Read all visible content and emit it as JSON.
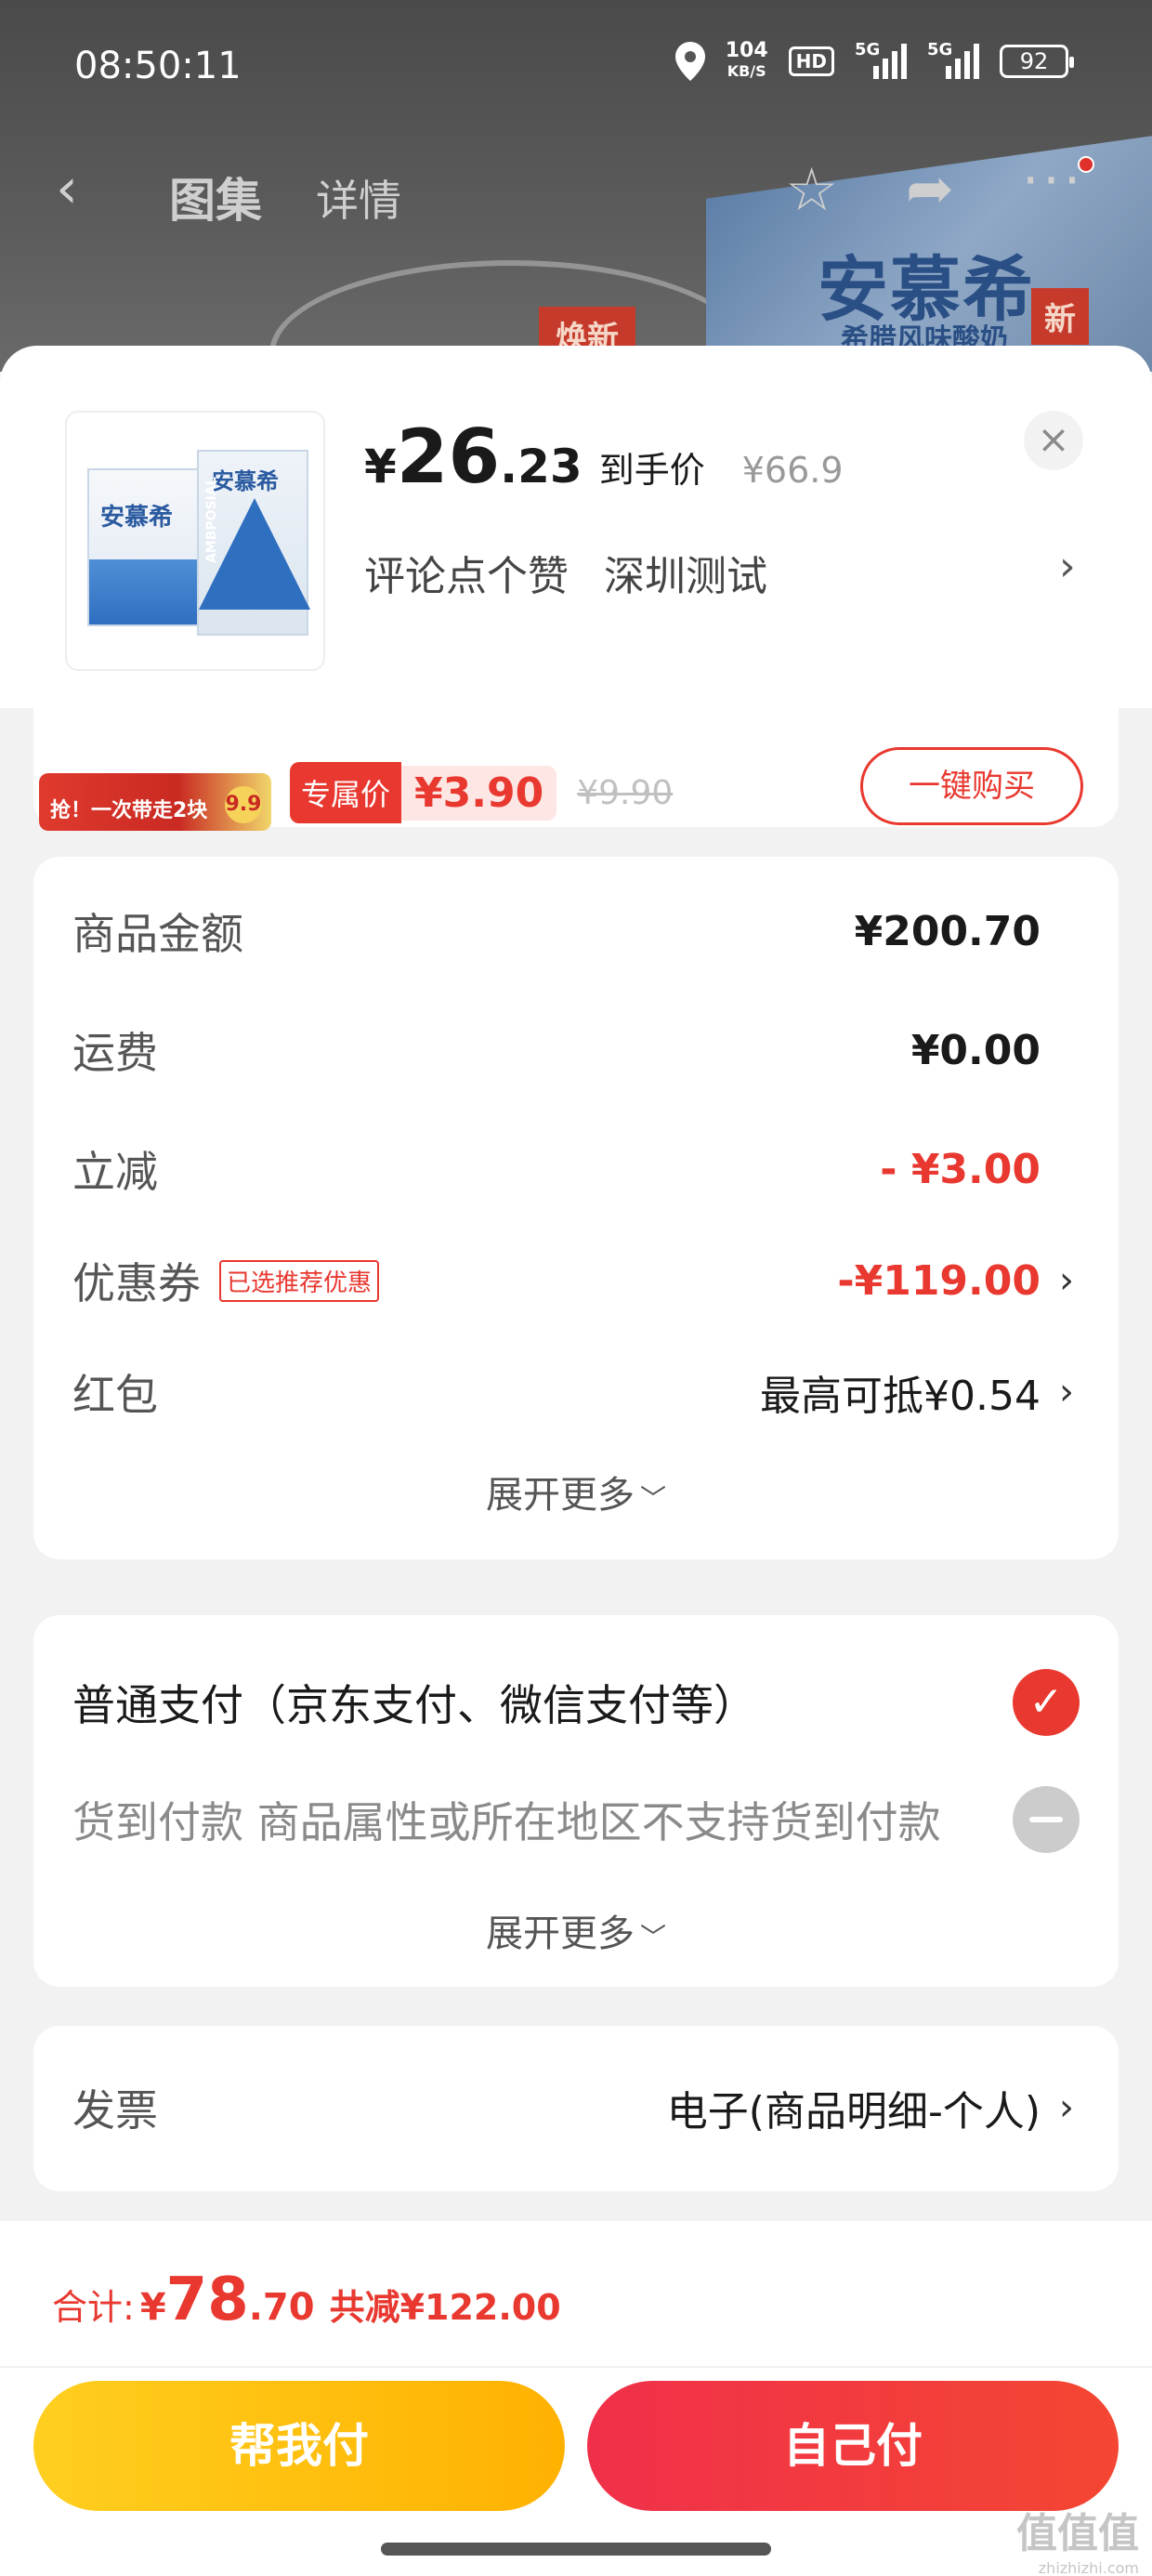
{
  "status_bar": {
    "time": "08:50:11",
    "net_speed_value": "104",
    "net_speed_unit": "KB/S",
    "hd": "HD",
    "signal_1": "5G",
    "signal_2": "5G",
    "battery": "92"
  },
  "background_page": {
    "tab_gallery": "图集",
    "tab_detail": "详情",
    "brand": "安慕希",
    "brand_sub": "希腊风味酸奶",
    "new_badge_1": "焕新",
    "new_badge_2": "新"
  },
  "sheet_header": {
    "price_symbol": "¥",
    "price_int": "26",
    "price_dec": ".23",
    "price_tag": "到手价",
    "original_price": "¥66.9",
    "comment": "评论点个赞",
    "location": "深圳测试",
    "close": "×",
    "chevron": "›",
    "thumb_brand": "安慕希",
    "thumb_brand_2": "安慕希",
    "thumb_side_text": "AMBPOSIAL"
  },
  "addon_card": {
    "banner_text": "抢！一次带走2块",
    "banner_badge": "9.9",
    "tag": "专属价",
    "price": "¥3.90",
    "original_price": "¥9.90",
    "buy_button": "一键购买"
  },
  "summary": {
    "rows": [
      {
        "label": "商品金额",
        "value": "¥200.70"
      },
      {
        "label": "运费",
        "value": "¥0.00"
      },
      {
        "label": "立减",
        "value": "- ¥3.00"
      },
      {
        "label": "优惠券",
        "tag": "已选推荐优惠",
        "value": "-¥119.00"
      },
      {
        "label": "红包",
        "value": "最高可抵¥0.54"
      }
    ],
    "expand": "展开更多",
    "chevron": "›"
  },
  "payment": {
    "normal": "普通支付（京东支付、微信支付等）",
    "cod": "货到付款 商品属性或所在地区不支持货到付款",
    "expand": "展开更多"
  },
  "invoice": {
    "label": "发票",
    "value": "电子(商品明细-个人)"
  },
  "footer": {
    "total_label": "合计:",
    "total_symbol": "¥",
    "total_int": "78",
    "total_dec": ".70",
    "total_save": "共减¥122.00",
    "help_pay": "帮我付",
    "self_pay": "自己付"
  },
  "watermark": {
    "text": "值值值",
    "sub": "zhizhizhi.com"
  },
  "colors": {
    "accent_red": "#e8382f",
    "help_yellow": "#ffb100",
    "self_red": "#f0304a"
  }
}
